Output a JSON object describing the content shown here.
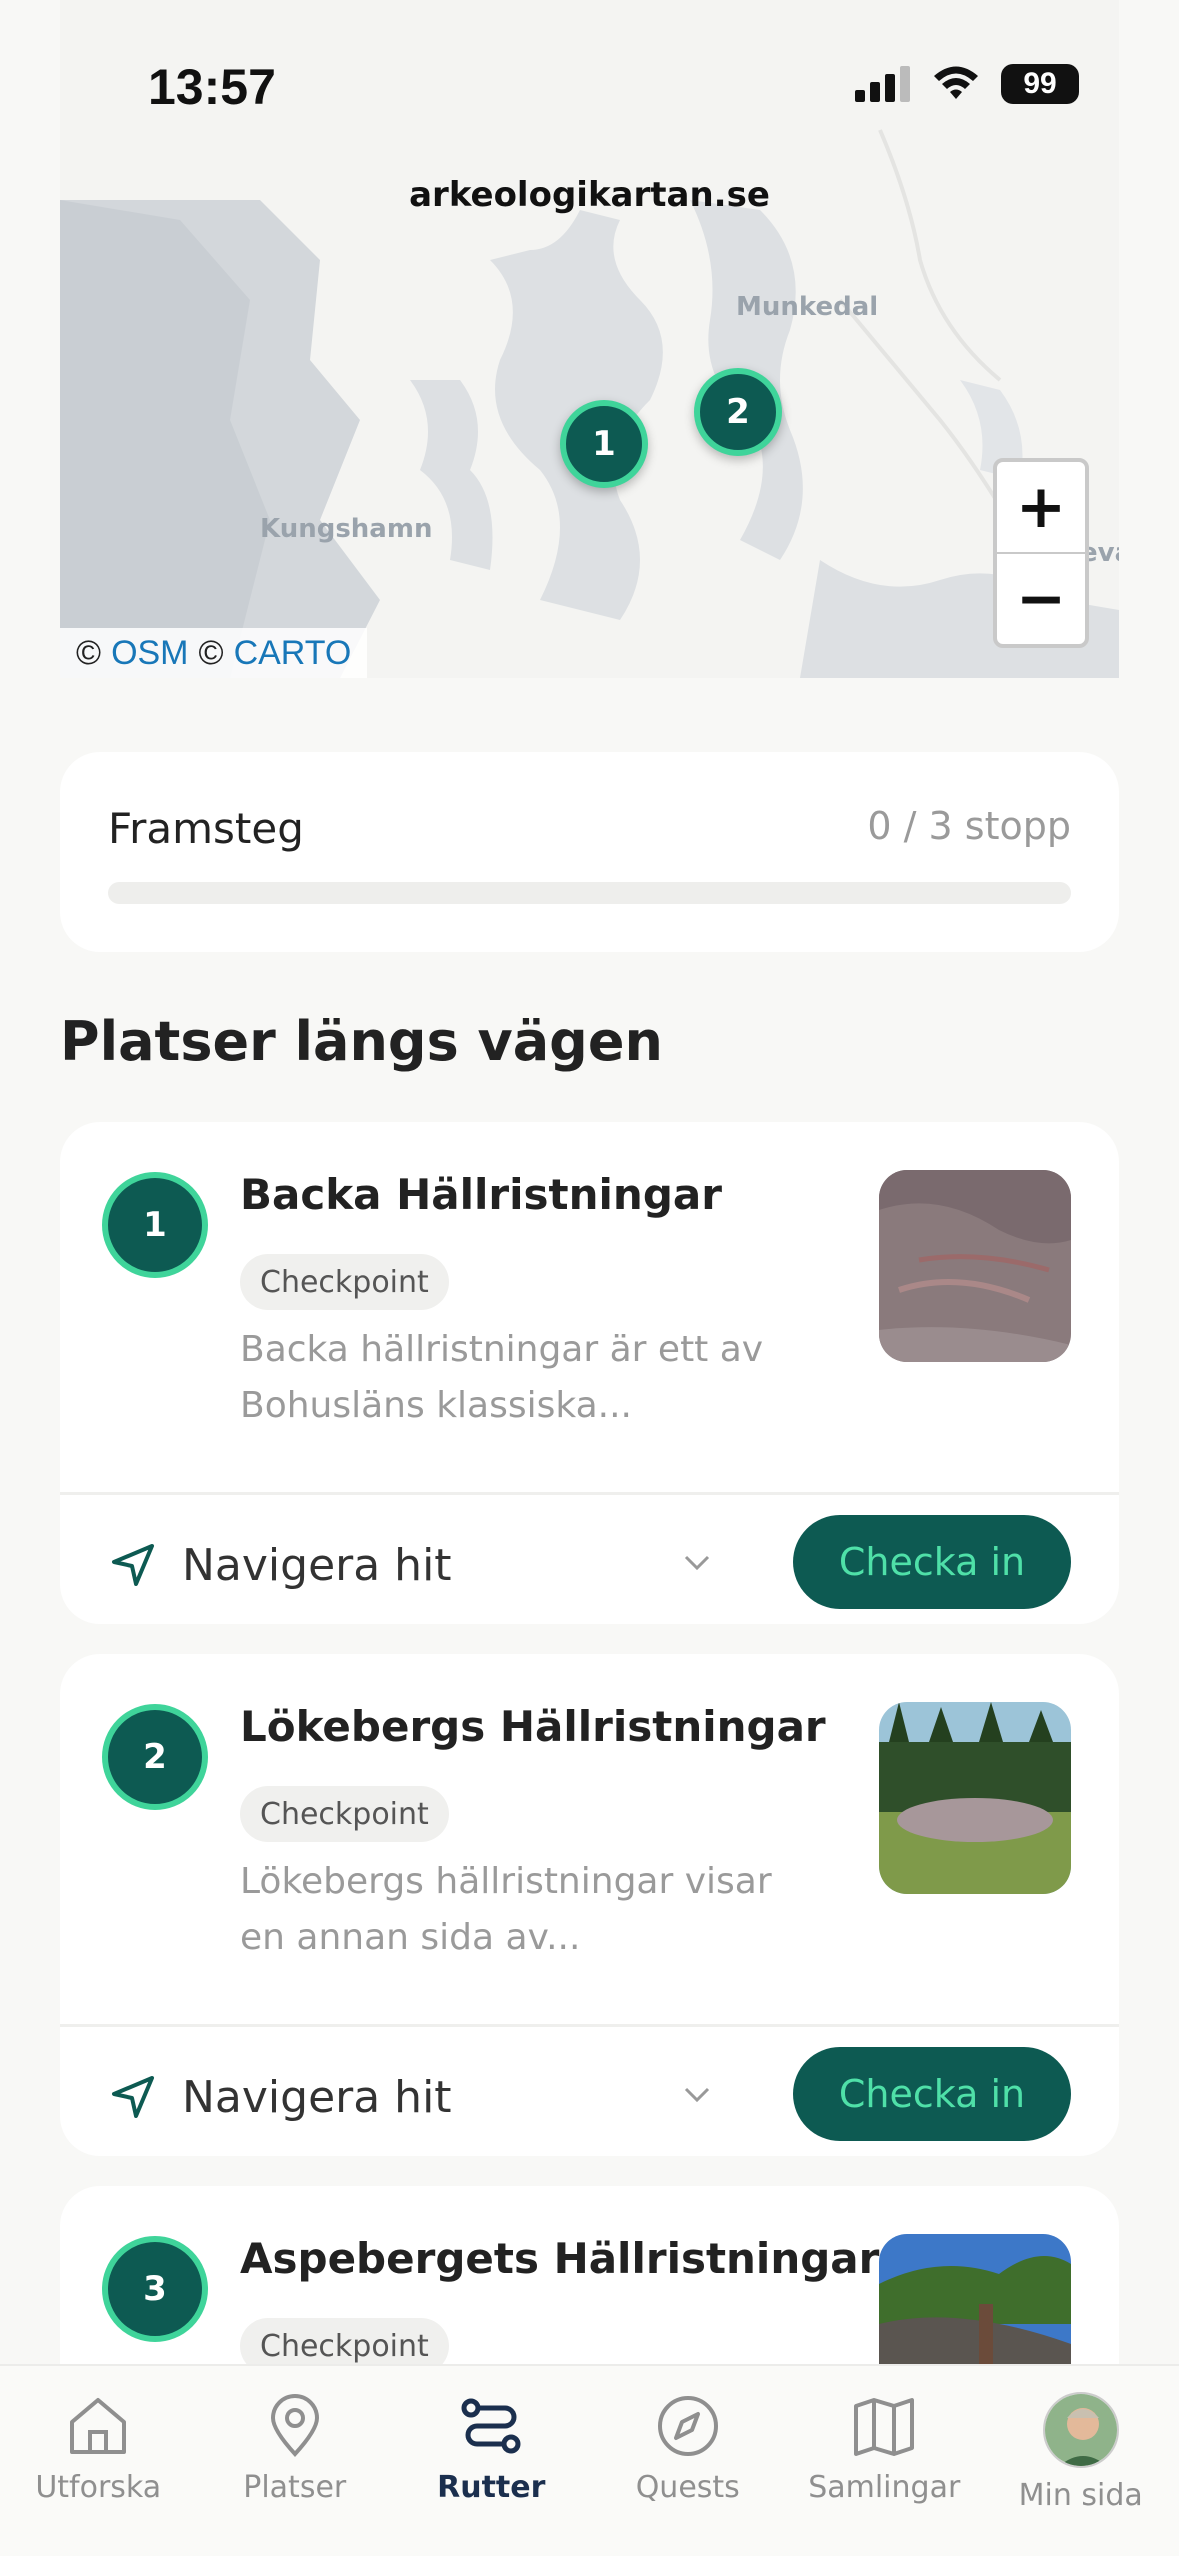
{
  "status_bar": {
    "time": "13:57",
    "battery": "99"
  },
  "map": {
    "source_url": "arkeologikartan.se",
    "labels": [
      "Munkedal",
      "Kungshamn",
      "eva"
    ],
    "markers": [
      "1",
      "2"
    ],
    "zoom_in": "+",
    "zoom_out": "−",
    "attribution": {
      "prefix": "©",
      "osm": "OSM",
      "sep": "©",
      "carto": "CARTO"
    }
  },
  "progress": {
    "title": "Framsteg",
    "count": "0 / 3 stopp",
    "fraction": 0
  },
  "section_title": "Platser längs vägen",
  "places": [
    {
      "number": "1",
      "name": "Backa Hällristningar",
      "tag": "Checkpoint",
      "description": "Backa hällristningar är ett av Bohusläns klassiska...",
      "navigate": "Navigera hit",
      "checkin": "Checka in"
    },
    {
      "number": "2",
      "name": "Lökebergs Hällristningar",
      "tag": "Checkpoint",
      "description": "Lökebergs hällristningar visar en annan sida av...",
      "navigate": "Navigera hit",
      "checkin": "Checka in"
    },
    {
      "number": "3",
      "name": "Aspebergets Hällristningar",
      "tag": "Checkpoint"
    }
  ],
  "bottom_nav": [
    {
      "label": "Utforska",
      "icon": "home-icon"
    },
    {
      "label": "Platser",
      "icon": "location-pin-icon"
    },
    {
      "label": "Rutter",
      "icon": "route-icon",
      "active": true
    },
    {
      "label": "Quests",
      "icon": "compass-icon"
    },
    {
      "label": "Samlingar",
      "icon": "map-icon"
    },
    {
      "label": "Min sida",
      "icon": "avatar"
    }
  ],
  "colors": {
    "primary": "#0d5a52",
    "accent": "#3fd49a",
    "active_nav": "#1b2f4e"
  }
}
